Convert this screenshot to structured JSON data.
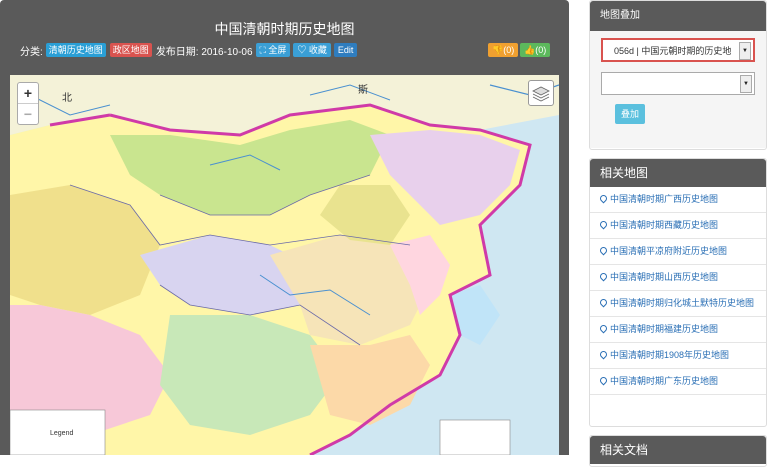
{
  "header": {
    "title": "中国清朝时期历史地图",
    "category_label": "分类:",
    "tag1": "清朝历史地图",
    "tag2": "政区地图",
    "date_label": "发布日期: 2016-10-06",
    "fullscreen_label": "全屏",
    "favorite_label": "收藏",
    "edit_label": "Edit",
    "vote_up": "(0)",
    "vote_down": "(0)"
  },
  "map": {
    "zoom_in": "+",
    "zoom_out": "−",
    "labels": {
      "north": "北",
      "si": "斯",
      "legend": "Legend"
    }
  },
  "overlay_panel": {
    "title": "地图叠加",
    "select1_value": "056d | 中国元朝时期的历史地",
    "select2_value": "",
    "add_button": "叠加"
  },
  "related_maps": {
    "title": "相关地图",
    "items": [
      "中国清朝时期广西历史地图",
      "中国清朝时期西藏历史地图",
      "中国清朝平凉府附近历史地图",
      "中国清朝时期山西历史地图",
      "中国清朝时期归化城土默特历史地图",
      "中国清朝时期福建历史地图",
      "中国清朝时期1908年历史地图",
      "中国清朝时期广东历史地图"
    ]
  },
  "related_docs": {
    "title": "相关文档"
  }
}
